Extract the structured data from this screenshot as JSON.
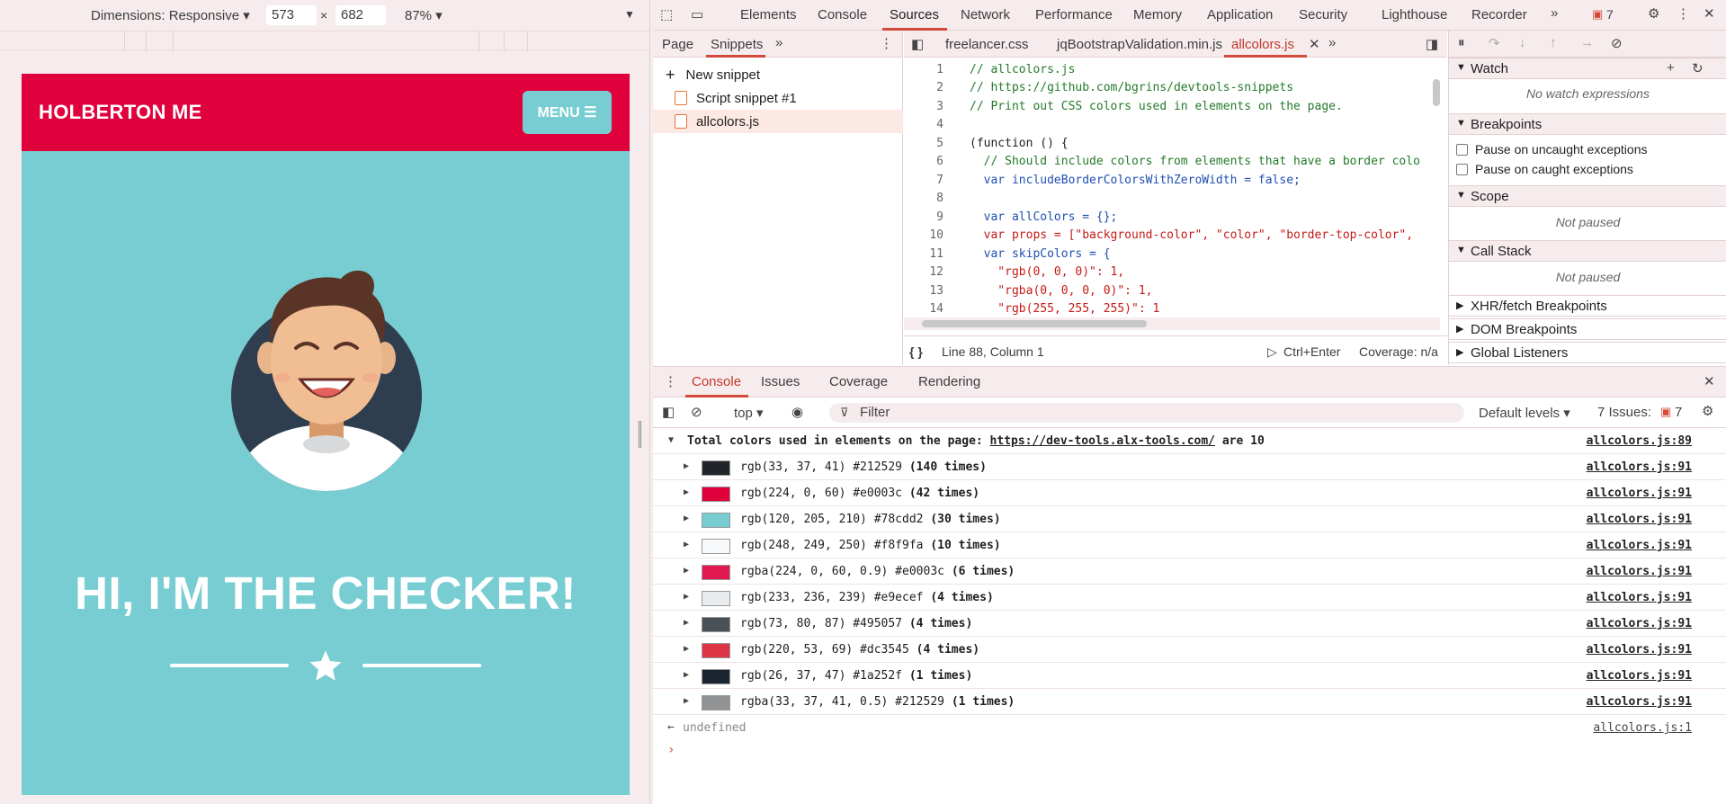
{
  "device_toolbar": {
    "dimensions_label": "Dimensions: Responsive ▾",
    "width": "573",
    "height": "682",
    "times": "×",
    "zoom": "87% ▾"
  },
  "site": {
    "brand": "HOLBERTON ME",
    "menu_label": "MENU ☰",
    "hero_title": "HI, I'M THE CHECKER!",
    "colors": {
      "header": "#e0003c",
      "body": "#78cdd2"
    }
  },
  "devtools": {
    "tabs": [
      "Elements",
      "Console",
      "Sources",
      "Network",
      "Performance",
      "Memory",
      "Application",
      "Security",
      "Lighthouse",
      "Recorder"
    ],
    "active_tab": "Sources",
    "issues_badge": "7",
    "navigator": {
      "tabs": [
        "Page",
        "Snippets"
      ],
      "new_snippet": "New snippet",
      "files": [
        "Script snippet #1",
        "allcolors.js"
      ]
    },
    "editor": {
      "tabs": [
        "freelancer.css",
        "jqBootstrapValidation.min.js",
        "allcolors.js"
      ],
      "lines": [
        "// allcolors.js",
        "// https://github.com/bgrins/devtools-snippets",
        "// Print out CSS colors used in elements on the page.",
        "",
        "(function () {",
        "  // Should include colors from elements that have a border colo",
        "  var includeBorderColorsWithZeroWidth = false;",
        "",
        "  var allColors = {};",
        "  var props = [\"background-color\", \"color\", \"border-top-color\",",
        "  var skipColors = {",
        "    \"rgb(0, 0, 0)\": 1,",
        "    \"rgba(0, 0, 0, 0)\": 1,",
        "    \"rgb(255, 255, 255)\": 1"
      ],
      "cursor": "Line 88, Column 1",
      "run_hint": "Ctrl+Enter",
      "coverage": "Coverage: n/a"
    },
    "debugger": {
      "watch": "Watch",
      "no_watch": "No watch expressions",
      "breakpoints": "Breakpoints",
      "pause_uncaught": "Pause on uncaught exceptions",
      "pause_caught": "Pause on caught exceptions",
      "scope": "Scope",
      "not_paused": "Not paused",
      "call_stack": "Call Stack",
      "xhr": "XHR/fetch Breakpoints",
      "dom": "DOM Breakpoints",
      "global": "Global Listeners"
    },
    "drawer": {
      "tabs": [
        "Console",
        "Issues",
        "Coverage",
        "Rendering"
      ],
      "context": "top ▾",
      "filter_placeholder": "Filter",
      "levels": "Default levels ▾",
      "issues": "7 Issues:",
      "issues_count": "7"
    },
    "console": {
      "header_text": "Total colors used in elements on the page: ",
      "header_url": "https://dev-tools.alx-tools.com/",
      "header_suffix": " are 10",
      "header_src": "allcolors.js:89",
      "rows": [
        {
          "swatch": "#212529",
          "text": "rgb(33, 37, 41) #212529 ",
          "count": "(140 times)",
          "src": "allcolors.js:91"
        },
        {
          "swatch": "#e0003c",
          "text": "rgb(224, 0, 60) #e0003c ",
          "count": "(42 times)",
          "src": "allcolors.js:91"
        },
        {
          "swatch": "#78cdd2",
          "text": "rgb(120, 205, 210) #78cdd2 ",
          "count": "(30 times)",
          "src": "allcolors.js:91"
        },
        {
          "swatch": "#f8f9fa",
          "text": "rgb(248, 249, 250) #f8f9fa ",
          "count": "(10 times)",
          "src": "allcolors.js:91"
        },
        {
          "swatch": "#e01a50",
          "text": "rgba(224, 0, 60, 0.9) #e0003c ",
          "count": "(6 times)",
          "src": "allcolors.js:91"
        },
        {
          "swatch": "#e9ecef",
          "text": "rgb(233, 236, 239) #e9ecef ",
          "count": "(4 times)",
          "src": "allcolors.js:91"
        },
        {
          "swatch": "#495057",
          "text": "rgb(73, 80, 87) #495057 ",
          "count": "(4 times)",
          "src": "allcolors.js:91"
        },
        {
          "swatch": "#dc3545",
          "text": "rgb(220, 53, 69) #dc3545 ",
          "count": "(4 times)",
          "src": "allcolors.js:91"
        },
        {
          "swatch": "#1a252f",
          "text": "rgb(26, 37, 47) #1a252f ",
          "count": "(1 times)",
          "src": "allcolors.js:91"
        },
        {
          "swatch": "#909294",
          "text": "rgba(33, 37, 41, 0.5) #212529 ",
          "count": "(1 times)",
          "src": "allcolors.js:91"
        }
      ],
      "result": "undefined",
      "result_src": "allcolors.js:1",
      "prompt": "›"
    }
  }
}
